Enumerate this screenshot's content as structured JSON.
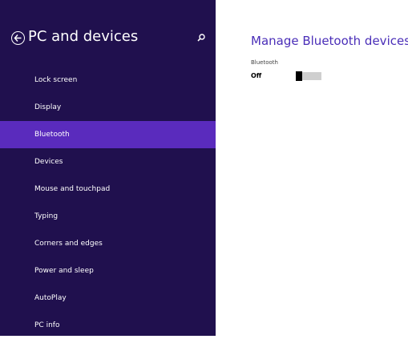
{
  "sidebar": {
    "title": "PC and devices",
    "items": [
      {
        "label": "Lock screen",
        "selected": false
      },
      {
        "label": "Display",
        "selected": false
      },
      {
        "label": "Bluetooth",
        "selected": true
      },
      {
        "label": "Devices",
        "selected": false
      },
      {
        "label": "Mouse and touchpad",
        "selected": false
      },
      {
        "label": "Typing",
        "selected": false
      },
      {
        "label": "Corners and edges",
        "selected": false
      },
      {
        "label": "Power and sleep",
        "selected": false
      },
      {
        "label": "AutoPlay",
        "selected": false
      },
      {
        "label": "PC info",
        "selected": false
      }
    ]
  },
  "main": {
    "title": "Manage Bluetooth devices",
    "setting": {
      "label": "Bluetooth",
      "state": "Off"
    }
  },
  "icons": {
    "back": "back-arrow-icon",
    "search": "search-icon"
  },
  "colors": {
    "sidebar_bg": "#20104e",
    "selected_bg": "#5a2bbd",
    "accent": "#4a2eb8"
  }
}
